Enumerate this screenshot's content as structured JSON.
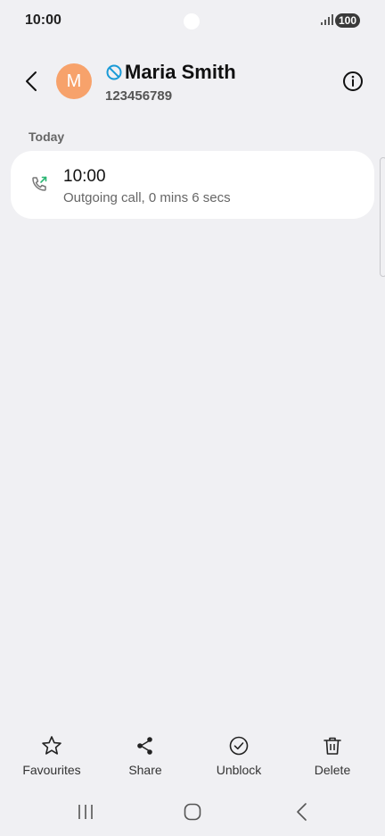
{
  "status_bar": {
    "time": "10:00",
    "battery": "100"
  },
  "header": {
    "avatar_letter": "M",
    "contact_name": "Maria Smith",
    "contact_number": "123456789",
    "blocked": true
  },
  "section_label": "Today",
  "calls": [
    {
      "time": "10:00",
      "detail": "Outgoing call, 0 mins 6 secs",
      "type": "outgoing"
    }
  ],
  "actions": [
    {
      "label": "Favourites",
      "icon": "star-icon"
    },
    {
      "label": "Share",
      "icon": "share-icon"
    },
    {
      "label": "Unblock",
      "icon": "check-circle-icon"
    },
    {
      "label": "Delete",
      "icon": "trash-icon"
    }
  ],
  "nav": [
    "recents-icon",
    "home-icon",
    "back-icon"
  ],
  "colors": {
    "background": "#f0f0f3",
    "avatar": "#f7a26b",
    "blocked": "#1a9bd7",
    "outgoing": "#2bb673"
  }
}
